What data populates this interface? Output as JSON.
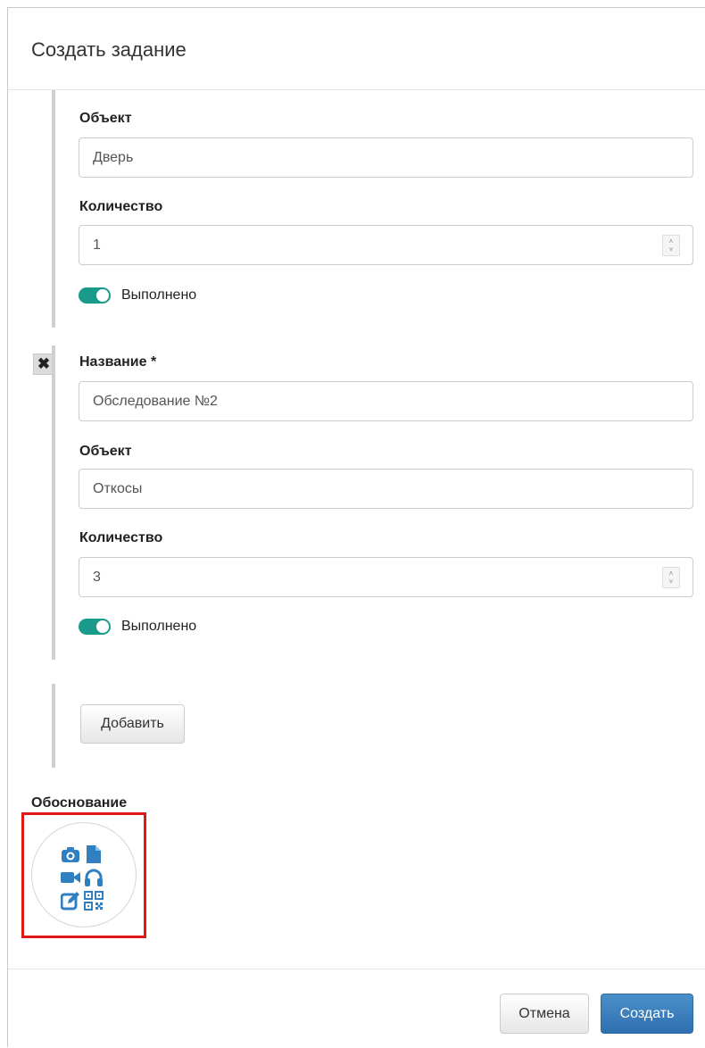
{
  "dialog": {
    "title": "Создать задание"
  },
  "item1": {
    "object_label": "Объект",
    "object_value": "Дверь",
    "quantity_label": "Количество",
    "quantity_value": "1",
    "done_label": "Выполнено",
    "done_on": true
  },
  "item2": {
    "name_label": "Название *",
    "name_value": "Обследование №2",
    "object_label": "Объект",
    "object_value": "Откосы",
    "quantity_label": "Количество",
    "quantity_value": "3",
    "done_label": "Выполнено",
    "done_on": true
  },
  "add_button": "Добавить",
  "justification": {
    "label": "Обоснование",
    "icons": [
      "camera-icon",
      "file-icon",
      "video-camera-icon",
      "headphones-icon",
      "edit-icon",
      "qr-code-icon"
    ]
  },
  "footer": {
    "cancel_label": "Отмена",
    "create_label": "Создать"
  },
  "colors": {
    "toggle_on": "#1a9a8a",
    "primary": "#337ab7",
    "icon_blue": "#2f7fc1",
    "highlight": "#e01818"
  }
}
